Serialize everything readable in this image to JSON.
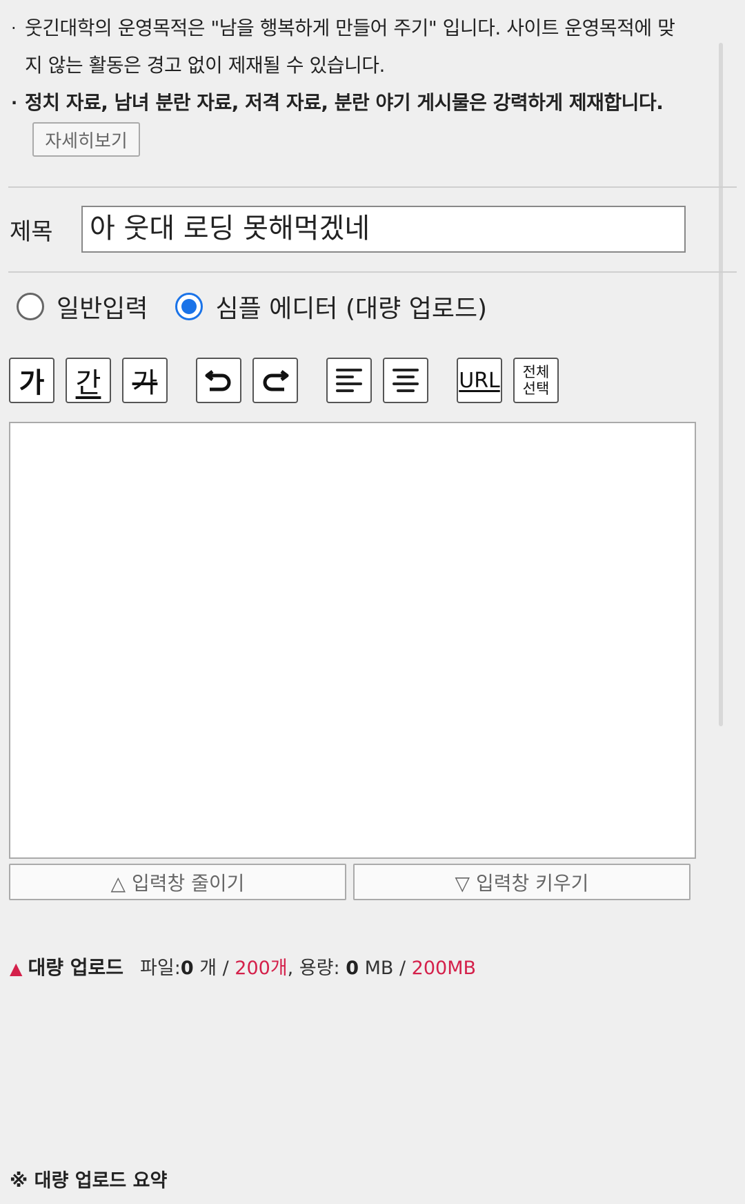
{
  "notice": {
    "line1": "웃긴대학의 운영목적은 \"남을 행복하게 만들어 주기\" 입니다. 사이트 운영목적에 맞",
    "line2": "지 않는 활동은 경고 없이 제재될 수 있습니다.",
    "line3": "정치 자료, 남녀 분란 자료, 저격 자료, 분란 야기 게시물은 강력하게 제재합니다.",
    "bullet": "·",
    "detail_button": "자세히보기"
  },
  "title_field": {
    "label": "제목",
    "value": "아 웃대 로딩 못해먹겠네"
  },
  "editor_mode": {
    "options": [
      {
        "label": "일반입력",
        "selected": false
      },
      {
        "label": "심플 에디터 (대량 업로드)",
        "selected": true
      }
    ],
    "accent_color": "#1a73e8"
  },
  "toolbar": {
    "bold": "가",
    "underline": "간",
    "strike": "가",
    "url": "URL",
    "select_all_1": "전체",
    "select_all_2": "선택"
  },
  "resize": {
    "shrink": "△ 입력창 줄이기",
    "grow": "▽ 입력창 키우기"
  },
  "upload": {
    "marker": "▲",
    "title": "대량 업로드",
    "files_label": "파일: ",
    "files_count": "0",
    "files_unit": " 개 / ",
    "files_max": "200개",
    "size_label": ", 용량: ",
    "size_value": "0",
    "size_unit": " MB / ",
    "size_max": "200MB",
    "highlight_color": "#d4204a"
  },
  "summary": {
    "title": "※ 대량 업로드 요약"
  }
}
